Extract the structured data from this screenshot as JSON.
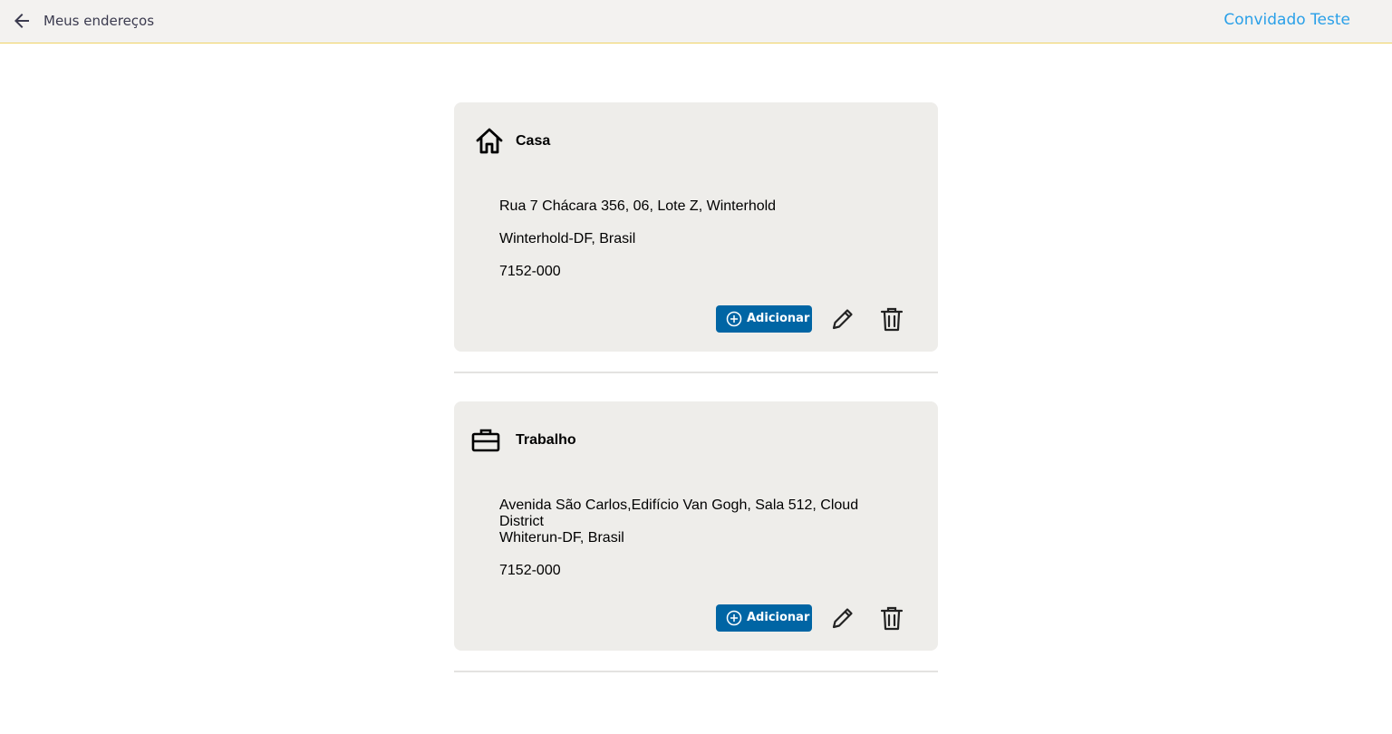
{
  "header": {
    "title": "Meus endereços",
    "user_name": "Convidado Teste"
  },
  "addresses": [
    {
      "type": "Casa",
      "icon": "house-icon",
      "line1": "Rua 7 Chácara 356, 06, Lote Z, Winterhold",
      "line2": "Winterhold-DF, Brasil",
      "zip": "7152-000",
      "add_label": "Adicionar"
    },
    {
      "type": "Trabalho",
      "icon": "briefcase-icon",
      "line1": "Avenida São Carlos,Edifício Van Gogh, Sala 512, Cloud District",
      "line2": "Whiterun-DF, Brasil",
      "zip": "7152-000",
      "add_label": "Adicionar"
    }
  ],
  "colors": {
    "accent": "#0065a4",
    "user_link": "#2aa0e8",
    "card_bg": "#eeedea",
    "header_bg": "#f3f2f0"
  }
}
